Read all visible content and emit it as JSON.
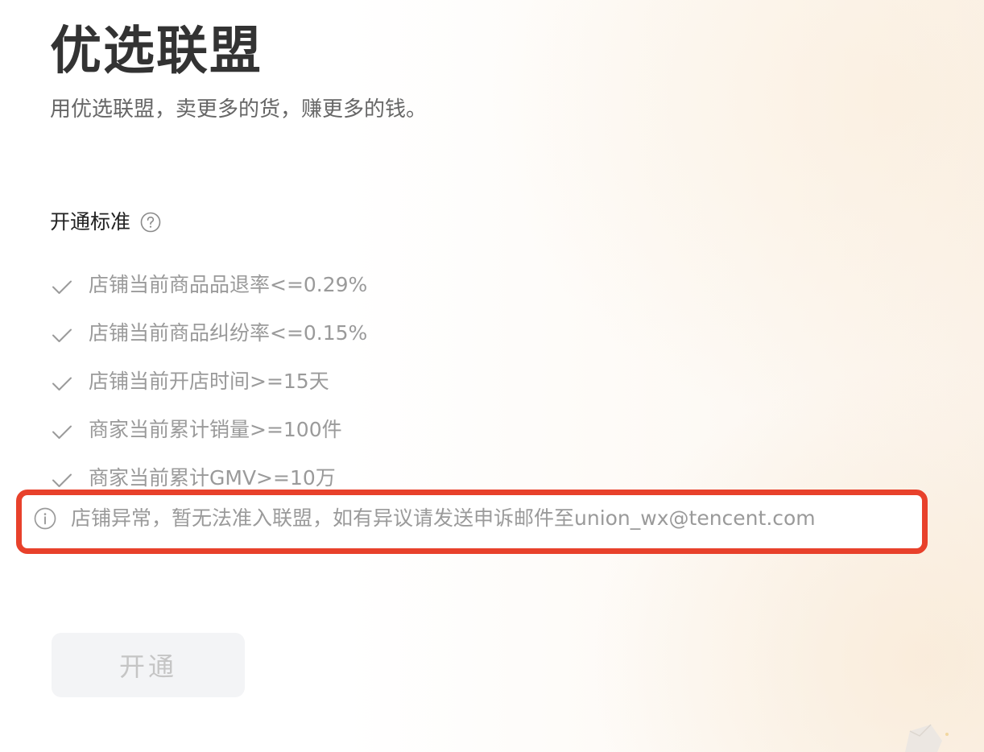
{
  "header": {
    "title": "优选联盟",
    "subtitle": "用优选联盟，卖更多的货，赚更多的钱。"
  },
  "requirements": {
    "title": "开通标准",
    "help_icon": "question-circle-icon",
    "items": [
      {
        "icon": "check-icon",
        "text": "店铺当前商品品退率<=0.29%"
      },
      {
        "icon": "check-icon",
        "text": "店铺当前商品纠纷率<=0.15%"
      },
      {
        "icon": "check-icon",
        "text": "店铺当前开店时间>=15天"
      },
      {
        "icon": "check-icon",
        "text": "商家当前累计销量>=100件"
      },
      {
        "icon": "check-icon",
        "text": "商家当前累计GMV>=10万"
      }
    ]
  },
  "alert": {
    "icon": "info-circle-icon",
    "text": "店铺异常，暂无法准入联盟，如有异议请发送申诉邮件至union_wx@tencent.com",
    "highlight_color": "#e8412b"
  },
  "actions": {
    "open_label": "开通",
    "open_disabled": true
  },
  "colors": {
    "title": "#333333",
    "muted_text": "#9a9a9a",
    "button_bg": "#f3f4f6"
  }
}
